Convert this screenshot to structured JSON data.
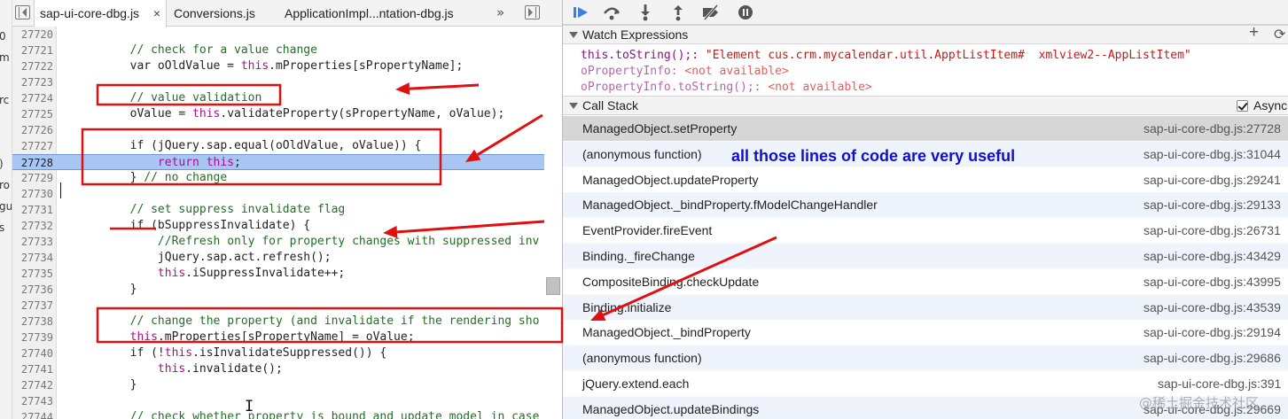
{
  "left_strip": {
    "fragments": [
      "0",
      "m",
      "rc",
      ")",
      "ro",
      "gu",
      "s"
    ]
  },
  "editor": {
    "tabs": [
      {
        "label": "sap-ui-core-dbg.js",
        "close": "×",
        "active": true
      },
      {
        "label": "Conversions.js",
        "active": false
      },
      {
        "label": "ApplicationImpl...ntation-dbg.js",
        "active": false
      }
    ],
    "more_tabs": "»",
    "cursor_glyph": "I",
    "lines": [
      {
        "num": "27720",
        "segments": []
      },
      {
        "num": "27721",
        "segments": [
          {
            "t": "        "
          },
          {
            "t": "// check for a value change",
            "c": "comment"
          }
        ]
      },
      {
        "num": "27722",
        "segments": [
          {
            "t": "        var oOldValue = "
          },
          {
            "t": "this",
            "c": "keyword"
          },
          {
            "t": ".mProperties[sPropertyName];"
          }
        ]
      },
      {
        "num": "27723",
        "segments": []
      },
      {
        "num": "27724",
        "segments": [
          {
            "t": "        "
          },
          {
            "t": "// value validation",
            "c": "comment"
          }
        ]
      },
      {
        "num": "27725",
        "segments": [
          {
            "t": "        oValue = "
          },
          {
            "t": "this",
            "c": "keyword"
          },
          {
            "t": ".validateProperty(sPropertyName, oValue);"
          }
        ]
      },
      {
        "num": "27726",
        "segments": []
      },
      {
        "num": "27727",
        "segments": [
          {
            "t": "        if (jQuery.sap.equal(oOldValue, oValue)) {"
          }
        ]
      },
      {
        "num": "27728",
        "highlight": true,
        "segments": [
          {
            "t": "            "
          },
          {
            "t": "return",
            "c": "keyword"
          },
          {
            "t": " "
          },
          {
            "t": "this",
            "c": "keyword"
          },
          {
            "t": ";"
          }
        ]
      },
      {
        "num": "27729",
        "segments": [
          {
            "t": "        } "
          },
          {
            "t": "// no change",
            "c": "comment"
          }
        ]
      },
      {
        "num": "27730",
        "segments": []
      },
      {
        "num": "27731",
        "segments": [
          {
            "t": "        "
          },
          {
            "t": "// set suppress invalidate flag",
            "c": "comment"
          }
        ]
      },
      {
        "num": "27732",
        "segments": [
          {
            "t": "        if (bSuppressInvalidate) {"
          }
        ]
      },
      {
        "num": "27733",
        "segments": [
          {
            "t": "            "
          },
          {
            "t": "//Refresh only for property changes with suppressed inv",
            "c": "comment"
          }
        ]
      },
      {
        "num": "27734",
        "segments": [
          {
            "t": "            jQuery.sap.act.refresh();"
          }
        ]
      },
      {
        "num": "27735",
        "segments": [
          {
            "t": "            "
          },
          {
            "t": "this",
            "c": "keyword"
          },
          {
            "t": ".iSuppressInvalidate++;"
          }
        ]
      },
      {
        "num": "27736",
        "segments": [
          {
            "t": "        }"
          }
        ]
      },
      {
        "num": "27737",
        "segments": []
      },
      {
        "num": "27738",
        "segments": [
          {
            "t": "        "
          },
          {
            "t": "// change the property (and invalidate if the rendering sho",
            "c": "comment"
          }
        ]
      },
      {
        "num": "27739",
        "segments": [
          {
            "t": "        "
          },
          {
            "t": "this",
            "c": "keyword"
          },
          {
            "t": ".mProperties[sPropertyName] = oValue;"
          }
        ]
      },
      {
        "num": "27740",
        "segments": [
          {
            "t": "        if (!"
          },
          {
            "t": "this",
            "c": "keyword"
          },
          {
            "t": ".isInvalidateSuppressed()) {"
          }
        ]
      },
      {
        "num": "27741",
        "segments": [
          {
            "t": "            "
          },
          {
            "t": "this",
            "c": "keyword"
          },
          {
            "t": ".invalidate();"
          }
        ]
      },
      {
        "num": "27742",
        "segments": [
          {
            "t": "        }"
          }
        ]
      },
      {
        "num": "27743",
        "segments": []
      },
      {
        "num": "27744",
        "segments": [
          {
            "t": "        "
          },
          {
            "t": "// check whether property is bound and update model in case",
            "c": "comment"
          }
        ]
      }
    ]
  },
  "debugger_toolbar": {
    "buttons": [
      "resume-icon",
      "step-over-icon",
      "step-into-icon",
      "step-out-icon",
      "deactivate-breakpoints-icon",
      "pause-on-exceptions-icon"
    ]
  },
  "watch": {
    "title": "Watch Expressions",
    "add": "+",
    "refresh": "⟳",
    "items": [
      {
        "expr": "this.toString();",
        "sep": ": ",
        "value": "\"Element cus.crm.mycalendar.util.ApptListItem#  xmlview2--AppListItem\"",
        "style": "strong"
      },
      {
        "expr": "oPropertyInfo",
        "sep": ": ",
        "value": "<not available>",
        "style": "dim"
      },
      {
        "expr": "oPropertyInfo.toString();",
        "sep": ": ",
        "value": "<not available>",
        "style": "dim"
      }
    ]
  },
  "callstack": {
    "title": "Call Stack",
    "async_label": "Async",
    "async_checked": true,
    "frames": [
      {
        "name": "ManagedObject.setProperty",
        "location": "sap-ui-core-dbg.js:27728",
        "selected": true
      },
      {
        "name": "(anonymous function)",
        "location": "sap-ui-core-dbg.js:31044"
      },
      {
        "name": "ManagedObject.updateProperty",
        "location": "sap-ui-core-dbg.js:29241"
      },
      {
        "name": "ManagedObject._bindProperty.fModelChangeHandler",
        "location": "sap-ui-core-dbg.js:29133"
      },
      {
        "name": "EventProvider.fireEvent",
        "location": "sap-ui-core-dbg.js:26731"
      },
      {
        "name": "Binding._fireChange",
        "location": "sap-ui-core-dbg.js:43429"
      },
      {
        "name": "CompositeBinding.checkUpdate",
        "location": "sap-ui-core-dbg.js:43995"
      },
      {
        "name": "Binding.initialize",
        "location": "sap-ui-core-dbg.js:43539"
      },
      {
        "name": "ManagedObject._bindProperty",
        "location": "sap-ui-core-dbg.js:29194"
      },
      {
        "name": "(anonymous function)",
        "location": "sap-ui-core-dbg.js:29686"
      },
      {
        "name": "jQuery.extend.each",
        "location": "sap-ui-core-dbg.js:391"
      },
      {
        "name": "ManagedObject.updateBindings",
        "location": "sap-ui-core-dbg.js:29669"
      }
    ]
  },
  "annotation": {
    "note": "all those lines of code are very useful",
    "color": "#e01010"
  },
  "watermark": "@稀土掘金技术社区",
  "colors": {
    "highlight_line": "#a8c6f3",
    "comment": "#236e25",
    "keyword": "#aa0d91",
    "note": "#1010cc",
    "callstack_alt_row": "#eef3fc",
    "selected_frame": "#d6d6d6"
  }
}
